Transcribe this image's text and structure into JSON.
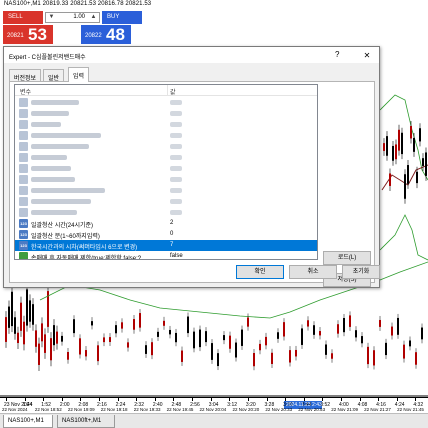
{
  "chart": {
    "title": "NAS100+,M1  20819.33 20821.53 20816.78 20821.53",
    "trade": {
      "sell_label": "SELL",
      "buy_label": "BUY",
      "lot_down": "▼",
      "lot_up": "▲",
      "lot_value": "1.00",
      "bid_prefix": "20821",
      "bid_big": "53",
      "ask_prefix": "20822",
      "ask_big": "48"
    },
    "colors": {
      "candle_up": "#000000",
      "candle_down": "#b00000",
      "bollinger": "#2e9c2e",
      "moving_average": "#7f1d1d",
      "sell": "#d9342b",
      "buy": "#2b5fd9"
    },
    "x_axis": [
      "23 Nov 2024",
      "1:44",
      "1:52",
      "2:00",
      "2:08",
      "2:16",
      "2:24",
      "2:32",
      "2:40",
      "2:48",
      "2:56",
      "3:04",
      "3:12",
      "3:20",
      "3:28",
      "3:36",
      "3:44",
      "3:52",
      "4:00",
      "4:08",
      "4:16",
      "4:24",
      "4:32"
    ],
    "x_axis_secondary": [
      "22 Nov 2024",
      "22 Nov 18:52",
      "22 Nov 19:09",
      "22 Nov 19:18",
      "22 Nov 19:33",
      "22 Nov 19:45",
      "22 Nov 20:04",
      "22 Nov 20:20",
      "22 Nov 20:33",
      "22 Nov 20:53",
      "22 Nov 21:09",
      "22 Nov 21:27",
      "22 Nov 21:45"
    ],
    "x_highlight_label": "2024.11.23 2:43",
    "sheet_tabs": [
      "NAS100+,M1",
      "NAS100ft+,M1"
    ]
  },
  "dialog": {
    "title": "Expert - C심플볼린저밴드매수",
    "help": "?",
    "close": "✕",
    "tabs": [
      "버전정보",
      "일반",
      "입력"
    ],
    "active_tab": 2,
    "grid": {
      "header_name": "변수",
      "header_value": "값",
      "rows": [
        {
          "icon": "",
          "type": "hidden",
          "name": "",
          "value": ""
        },
        {
          "icon": "",
          "type": "hidden",
          "name": "",
          "value": ""
        },
        {
          "icon": "",
          "type": "hidden",
          "name": "",
          "value": ""
        },
        {
          "icon": "",
          "type": "hidden",
          "name": "",
          "value": ""
        },
        {
          "icon": "",
          "type": "hidden",
          "name": "",
          "value": ""
        },
        {
          "icon": "",
          "type": "hidden",
          "name": "",
          "value": ""
        },
        {
          "icon": "",
          "type": "hidden",
          "name": "",
          "value": ""
        },
        {
          "icon": "",
          "type": "hidden",
          "name": "",
          "value": ""
        },
        {
          "icon": "",
          "type": "hidden",
          "name": "",
          "value": ""
        },
        {
          "icon": "",
          "type": "hidden",
          "name": "",
          "value": ""
        },
        {
          "icon": "",
          "type": "hidden",
          "name": "",
          "value": ""
        },
        {
          "icon": "123",
          "type": "int",
          "name": "일괄청산 시간(24시기준)",
          "value": "2"
        },
        {
          "icon": "123",
          "type": "int",
          "name": "일괄청산 분(1~60까지입력)",
          "value": "0"
        },
        {
          "icon": "123",
          "type": "int",
          "name": "한국시간과의 시차(써머타임시 6으로 변경)",
          "value": "7"
        },
        {
          "icon": "",
          "type": "bool",
          "name": "손매매 후 자동매매 제한(true:제한함,false:?...",
          "value": "false"
        },
        {
          "icon": "",
          "type": "bool",
          "name": "Bid(현재가) 사용여부(true:Bid, false:Close[0])",
          "value": "false"
        }
      ],
      "selected_row": 13
    },
    "buttons": {
      "load": "로드(L)",
      "save": "저장(S)",
      "ok": "확인",
      "cancel": "취소",
      "reset": "초기화"
    }
  }
}
